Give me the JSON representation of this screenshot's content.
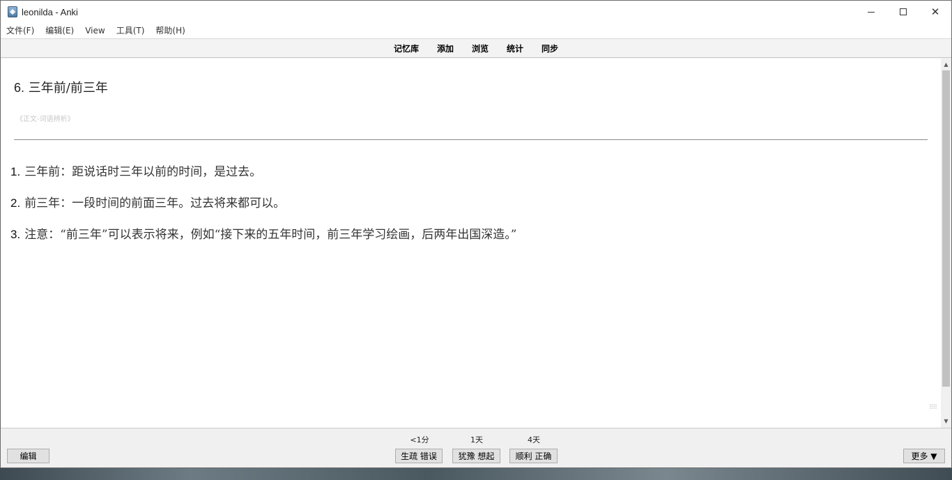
{
  "window": {
    "title": "leonilda - Anki"
  },
  "menu": {
    "items": [
      "文件(F)",
      "编辑(E)",
      "View",
      "工具(T)",
      "帮助(H)"
    ]
  },
  "toolbar": {
    "items": [
      "记忆库",
      "添加",
      "浏览",
      "统计",
      "同步"
    ]
  },
  "card": {
    "question_number": "6.",
    "question_text": "三年前/前三年",
    "source": "《正文-词语辨析》",
    "answers": [
      {
        "num": "1.",
        "text": "三年前：距说话时三年以前的时间，是过去。"
      },
      {
        "num": "2.",
        "text": "前三年：一段时间的前面三年。过去将来都可以。"
      },
      {
        "num": "3.",
        "text": "注意：“前三年”可以表示将来，例如“接下来的五年时间，前三年学习绘画，后两年出国深造。”"
      }
    ]
  },
  "review": {
    "edit_label": "编辑",
    "more_label": "更多 ▼",
    "answers": [
      {
        "interval": "<1分",
        "label": "生疏 错误"
      },
      {
        "interval": "1天",
        "label": "犹豫 想起"
      },
      {
        "interval": "4天",
        "label": "顺利 正确"
      }
    ]
  },
  "icons": {
    "app": "anki-icon",
    "minimize": "minimize-icon",
    "maximize": "maximize-icon",
    "close": "close-icon"
  }
}
